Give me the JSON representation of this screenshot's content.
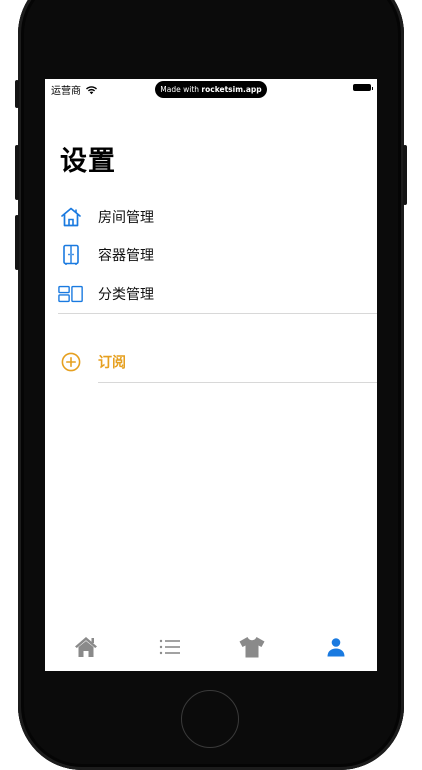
{
  "status_bar": {
    "carrier": "运营商",
    "badge_prefix": "Made with ",
    "badge_brand": "rocketsim.app"
  },
  "page": {
    "title": "设置"
  },
  "settings": {
    "items": [
      {
        "label": "房间管理",
        "icon": "house-icon"
      },
      {
        "label": "容器管理",
        "icon": "cabinet-icon"
      },
      {
        "label": "分类管理",
        "icon": "category-icon"
      }
    ],
    "subscription": {
      "label": "订阅",
      "icon": "plus-circle-icon"
    }
  },
  "tabbar": {
    "tabs": [
      {
        "icon": "home-icon",
        "selected": false
      },
      {
        "icon": "list-icon",
        "selected": false
      },
      {
        "icon": "shirt-icon",
        "selected": false
      },
      {
        "icon": "person-icon",
        "selected": true
      }
    ]
  },
  "colors": {
    "accent_blue": "#1a7ae0",
    "accent_orange": "#e6a020",
    "tab_inactive": "#8a8a8a"
  }
}
